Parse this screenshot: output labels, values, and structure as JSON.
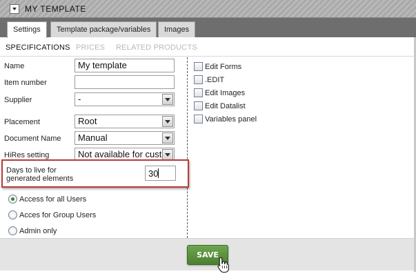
{
  "window": {
    "title": "MY TEMPLATE"
  },
  "tabs": [
    {
      "label": "Settings",
      "active": true
    },
    {
      "label": "Template package/variables",
      "active": false
    },
    {
      "label": "Images",
      "active": false
    }
  ],
  "subtabs": [
    {
      "label": "SPECIFICATIONS",
      "active": true
    },
    {
      "label": "PRICES",
      "active": false
    },
    {
      "label": "RELATED PRODUCTS",
      "active": false
    }
  ],
  "form": {
    "name": {
      "label": "Name",
      "value": "My template"
    },
    "item_number": {
      "label": "Item number",
      "value": ""
    },
    "supplier": {
      "label": "Supplier",
      "value": "-"
    },
    "placement": {
      "label": "Placement",
      "value": "Root"
    },
    "document_name": {
      "label": "Document Name",
      "value": "Manual"
    },
    "hires": {
      "label": "HiRes setting",
      "value": "Not available for customers"
    },
    "days_to_live": {
      "label_line1": "Days to live for",
      "label_line2": "generated elements",
      "value": "30"
    }
  },
  "access": [
    {
      "label": "Access for all Users",
      "checked": true
    },
    {
      "label": "Acces for Group Users",
      "checked": false
    },
    {
      "label": "Admin only",
      "checked": false
    }
  ],
  "permissions": [
    {
      "label": "Edit Forms",
      "checked": false
    },
    {
      "label": ".EDIT",
      "checked": false
    },
    {
      "label": "Edit Images",
      "checked": false
    },
    {
      "label": "Edit Datalist",
      "checked": false
    },
    {
      "label": "Variables panel",
      "checked": false
    }
  ],
  "footer": {
    "save_label": "SAVE"
  },
  "colors": {
    "save_green": "#5a9440",
    "highlight_red": "#b83a3a",
    "tabbar_gray": "#6e6e6e"
  },
  "icons": {
    "collapse": "chevron-down-icon",
    "cursor": "hand-pointer-icon"
  }
}
